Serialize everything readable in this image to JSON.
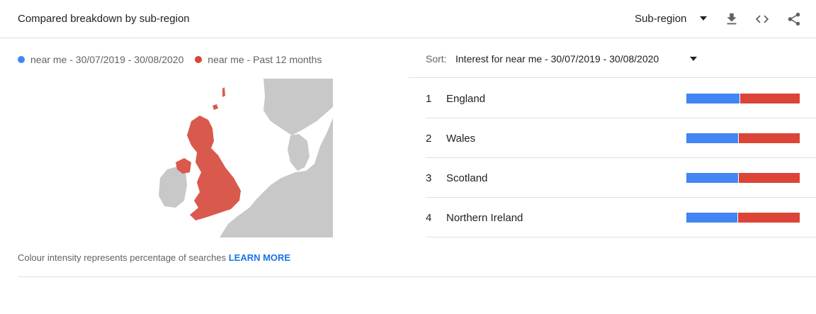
{
  "header": {
    "title": "Compared breakdown by sub-region",
    "resolution_select": "Sub-region",
    "icons": [
      "download-icon",
      "embed-icon",
      "share-icon"
    ]
  },
  "legend": {
    "series": [
      {
        "label": "near me - 30/07/2019 - 30/08/2020",
        "color": "#4285f4"
      },
      {
        "label": "near me - Past 12 months",
        "color": "#db4437"
      }
    ]
  },
  "sort": {
    "label": "Sort:",
    "value": "Interest for near me - 30/07/2019 - 30/08/2020"
  },
  "regions": [
    {
      "rank": "1",
      "name": "England",
      "share_a": 0.47,
      "share_b": 0.53
    },
    {
      "rank": "2",
      "name": "Wales",
      "share_a": 0.46,
      "share_b": 0.54
    },
    {
      "rank": "3",
      "name": "Scotland",
      "share_a": 0.46,
      "share_b": 0.54
    },
    {
      "rank": "4",
      "name": "Northern Ireland",
      "share_a": 0.45,
      "share_b": 0.55
    }
  ],
  "footnote": {
    "text": "Colour intensity represents percentage of searches ",
    "link": "LEARN MORE"
  },
  "colors": {
    "series_a": "#4285f4",
    "series_b": "#db4437",
    "map_land": "#c8c8c8",
    "map_highlight": "#d9594c"
  }
}
